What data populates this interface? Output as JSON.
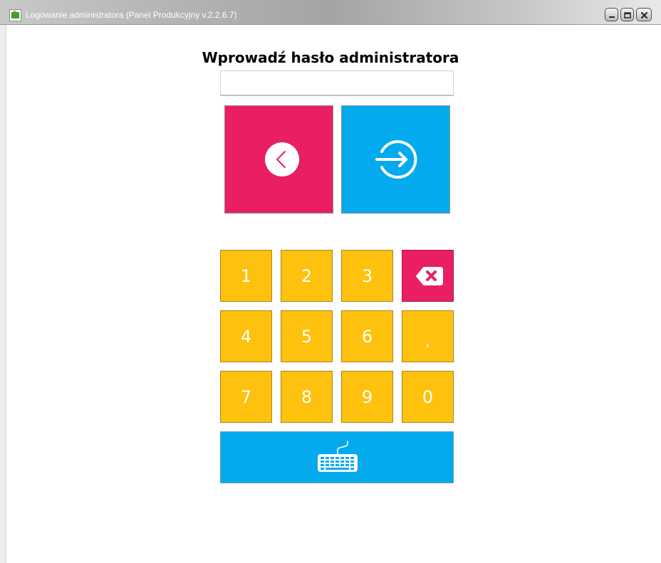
{
  "window": {
    "title": "Logowanie administratora (Panel Produkcyjny v.2.2.6.7)",
    "controls": [
      "minimize",
      "maximize",
      "close"
    ]
  },
  "login": {
    "prompt": "Wprowadź hasło administratora",
    "password_value": "",
    "back_icon": "chevron-left-circle-icon",
    "login_icon": "sign-in-arrow-icon"
  },
  "keypad": {
    "keys": [
      "1",
      "2",
      "3",
      "4",
      "5",
      "6",
      ",",
      "7",
      "8",
      "9",
      "0"
    ],
    "delete_icon": "backspace-icon",
    "keyboard_icon": "keyboard-icon"
  },
  "colors": {
    "pink": "#ea1f63",
    "blue": "#03aaed",
    "amber": "#fec10d"
  }
}
